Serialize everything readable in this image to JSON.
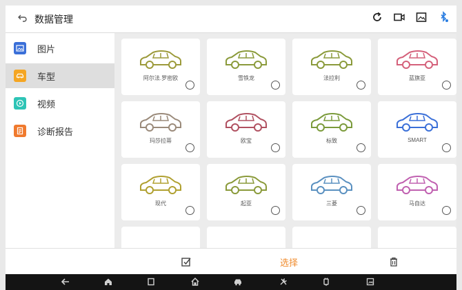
{
  "header": {
    "back_icon": "back-arrow-icon",
    "title": "数据管理",
    "icons": [
      "refresh-icon",
      "video-record-icon",
      "gallery-icon",
      "bluetooth-icon"
    ]
  },
  "sidebar": {
    "items": [
      {
        "label": "图片",
        "icon": "image-icon",
        "color": "#3a6fd8",
        "active": false
      },
      {
        "label": "车型",
        "icon": "car-icon",
        "color": "#f5a623",
        "active": true
      },
      {
        "label": "视频",
        "icon": "video-icon",
        "color": "#2ec4b6",
        "active": false
      },
      {
        "label": "诊断报告",
        "icon": "report-icon",
        "color": "#f07a2e",
        "active": false
      }
    ]
  },
  "cars": [
    {
      "name": "阿尔法.罗密欧",
      "color": "#9c9a3a"
    },
    {
      "name": "雪铁龙",
      "color": "#8a9a3a"
    },
    {
      "name": "法拉利",
      "color": "#8a9a3a"
    },
    {
      "name": "蓝旗亚",
      "color": "#d4607a"
    },
    {
      "name": "玛莎拉蒂",
      "color": "#9a8a7a"
    },
    {
      "name": "欧宝",
      "color": "#b05060"
    },
    {
      "name": "标致",
      "color": "#7a9a3a"
    },
    {
      "name": "SMART",
      "color": "#3a6fd8"
    },
    {
      "name": "现代",
      "color": "#b0a030"
    },
    {
      "name": "起亚",
      "color": "#8a9a3a"
    },
    {
      "name": "三菱",
      "color": "#5a90c0"
    },
    {
      "name": "马自达",
      "color": "#c060b0"
    }
  ],
  "actions": {
    "select_all_icon": "select-all-icon",
    "select_label": "选择",
    "delete_icon": "trash-icon",
    "accent": "#f08c2e"
  },
  "navbar": {
    "icons": [
      "nav-back-icon",
      "home-icon",
      "recent-apps-icon",
      "house-icon",
      "car-diagnose-icon",
      "tools-icon",
      "vci-icon",
      "screenshot-icon"
    ]
  }
}
